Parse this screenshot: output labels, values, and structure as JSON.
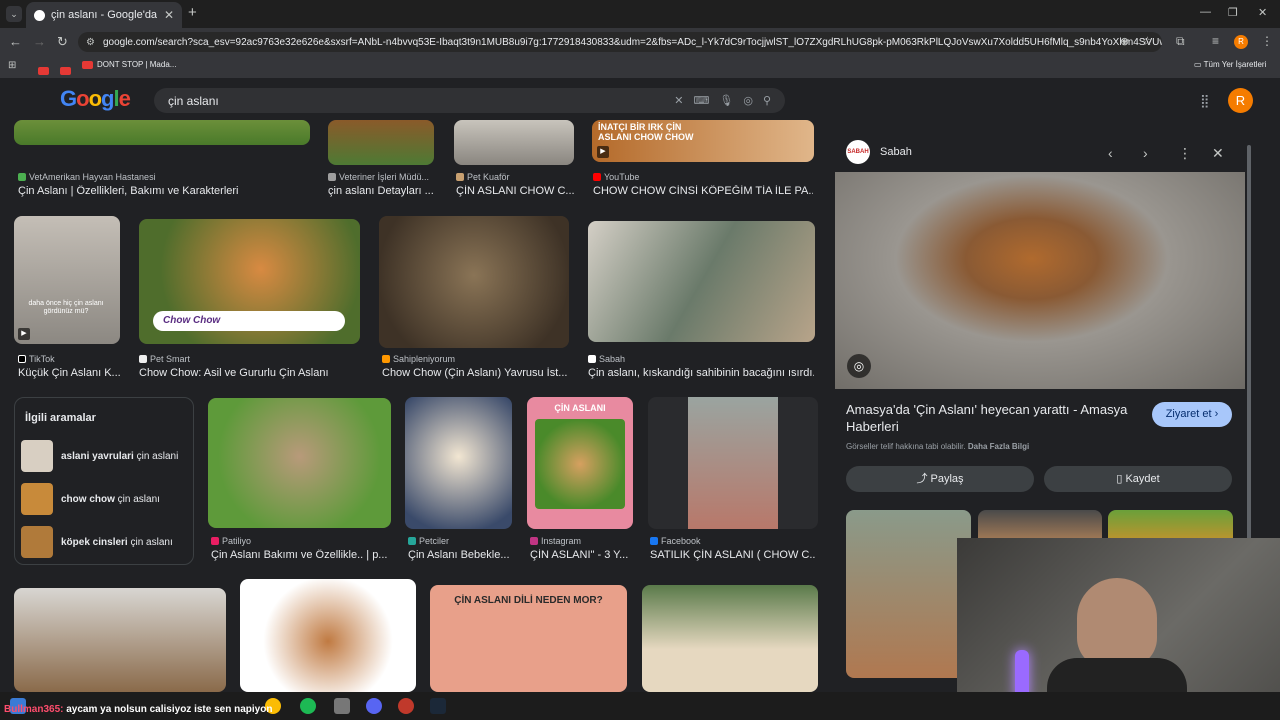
{
  "browser": {
    "tab_title": "çin aslanı - Google'da Ara",
    "url": "google.com/search?sca_esv=92ac9763e32e626e&sxsrf=ANbL-n4bvvq53E-Ibaqt3t9n1MUB8u9i7g:1772918430833&udm=2&fbs=ADc_l-Yk7dC9rTocjjwlST_lO7ZXgdRLhUG8pk-pM063RkPlLQJoVswXu7Xoldd5UH6fMlq_s9nb4YoXhm4SVUwlynGO-...",
    "bookmark_1": "DONT STOP | Mada...",
    "bookmark_folder": "Tüm Yer İşaretleri",
    "profile_initial": "R"
  },
  "search": {
    "query": "çin aslanı",
    "logo": "Google"
  },
  "results": [
    {
      "source": "VetAmerikan Hayvan Hastanesi",
      "caption": "Çin Aslanı | Özellikleri, Bakımı ve Karakterleri",
      "color": "#5a7d3a"
    },
    {
      "source": "Veteriner İşleri Müdü...",
      "caption": "çin aslanı Detayları ...",
      "color": "#7a5a2e"
    },
    {
      "source": "Pet Kuaför",
      "caption": "ÇİN ASLANI CHOW C...",
      "color": "#a58a6a"
    },
    {
      "source": "YouTube",
      "caption": "CHOW CHOW CİNSİ KÖPEĞİM TİA İLE PA...",
      "color": "#b46a2a"
    },
    {
      "source": "TikTok",
      "caption": "Küçük Çin Aslanı K...",
      "color": "#9a9690"
    },
    {
      "source": "Pet Smart",
      "caption": "Chow Chow: Asil ve Gururlu Çin Aslanı",
      "color": "#c67a3a"
    },
    {
      "source": "Sahipleniyorum",
      "caption": "Chow Chow (Çin Aslanı) Yavrusu İst...",
      "color": "#6e5a44"
    },
    {
      "source": "Sabah",
      "caption": "Çin aslanı, kıskandığı sahibinin bacağını ısırdı...",
      "color": "#c8c2b8"
    },
    {
      "source": "Patiliyo",
      "caption": "Çin Aslanı Bakımı ve Özellikle.. | p...",
      "color": "#7aa04a"
    },
    {
      "source": "Petciler",
      "caption": "Çin Aslanı Bebekle...",
      "color": "#e8d8c0"
    },
    {
      "source": "Instagram",
      "caption": "ÇİN ASLANI\" - 3 Y...",
      "color": "#e89aa8"
    },
    {
      "source": "Facebook",
      "caption": "SATILIK ÇİN ASLANI ( CHOW C...",
      "color": "#8a6a5a"
    }
  ],
  "overlay_texts": {
    "chow_chow_pill": "Chow Chow",
    "youtube_thumb": "İNATÇI BİR IRK ÇİN ASLANI CHOW CHOW",
    "tiktok_thumb": "daha önce hiç çin aslanı gördünüz mü?",
    "instagram_thumb": "ÇİN ASLANI",
    "bottom_banner": "ÇİN ASLANI DİLİ NEDEN MOR?"
  },
  "related": {
    "heading": "İlgili aramalar",
    "items": [
      {
        "bold": "aslani yavrulari",
        "rest": " çin aslani"
      },
      {
        "bold": "chow chow",
        "rest": " çin aslanı"
      },
      {
        "bold": "köpek cinsleri",
        "rest": " çin aslanı"
      }
    ]
  },
  "panel": {
    "source": "Sabah",
    "source_logo": "SABAH",
    "title": "Amasya'da 'Çin Aslanı' heyecan yarattı - Amasya Haberleri",
    "visit_label": "Ziyaret et",
    "copyright": "Görseller telif hakkına tabi olabilir.",
    "more_info": "Daha Fazla Bilgi",
    "share_label": "Paylaş",
    "save_label": "Kaydet"
  },
  "stream": {
    "chat_user": "Bullman365:",
    "chat_text": " aycam ya nolsun calisiyoz iste sen napiyon"
  }
}
